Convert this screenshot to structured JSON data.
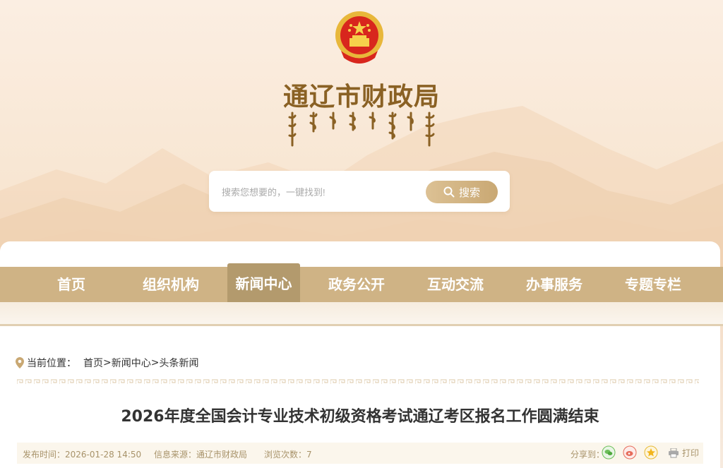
{
  "site": {
    "title": "通辽市财政局",
    "emblem_icon": "national-emblem-icon",
    "mongolian_script_icon": "mongolian-script-title"
  },
  "search": {
    "placeholder": "搜索您想要的，一键找到!",
    "button_label": "搜索",
    "icon": "search-icon"
  },
  "nav": {
    "items": [
      {
        "label": "首页"
      },
      {
        "label": "组织机构"
      },
      {
        "label": "新闻中心",
        "active": true
      },
      {
        "label": "政务公开"
      },
      {
        "label": "互动交流"
      },
      {
        "label": "办事服务"
      },
      {
        "label": "专题专栏"
      }
    ]
  },
  "breadcrumb": {
    "icon": "location-pin-icon",
    "label": "当前位置：",
    "items": [
      "首页",
      "新闻中心",
      "头条新闻"
    ],
    "separator": ">"
  },
  "article": {
    "title": "2026年度全国会计专业技术初级资格考试通辽考区报名工作圆满结束",
    "publish_time": "发布时间：2026-01-28 14:50",
    "source": "信息来源：通辽市财政局",
    "views": "浏览次数：7",
    "share_label": "分享到：",
    "print_label": "打印"
  },
  "colors": {
    "nav_bg": "#cfb385",
    "nav_active": "#b39a6d",
    "title_gold": "#8a6124",
    "meta_text": "#a8936a"
  }
}
